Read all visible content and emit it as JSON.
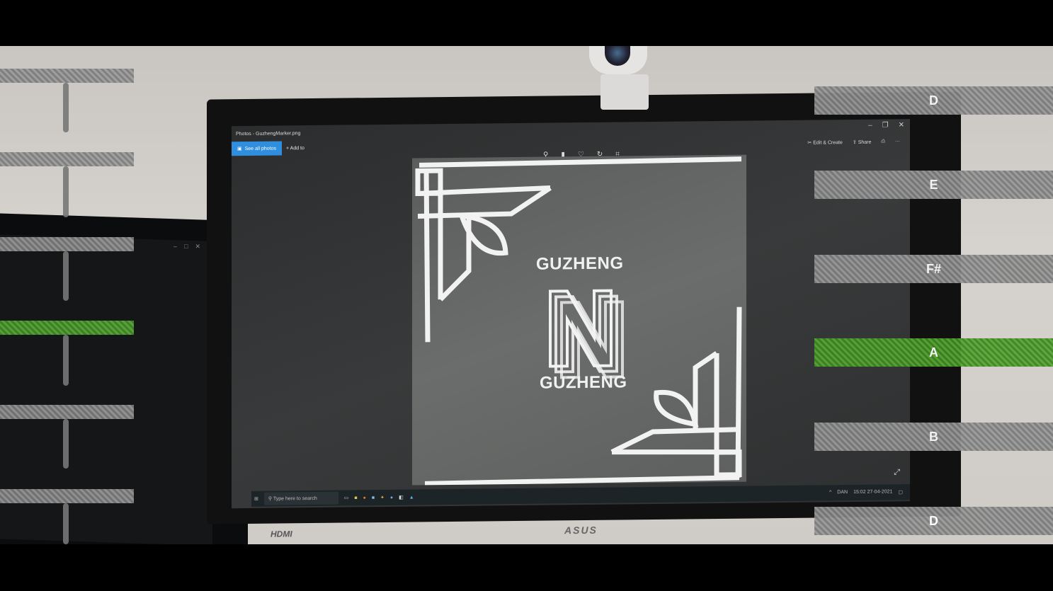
{
  "photos_app": {
    "window_title": "Photos - GuzhengMarker.png",
    "see_all_photos": "See all photos",
    "add_to": "Add to",
    "edit_create": "Edit & Create",
    "share": "Share",
    "more": "···",
    "image": {
      "logo_top": "GUZHENG",
      "logo_letter": "N",
      "logo_bottom": "GUZHENG"
    }
  },
  "taskbar": {
    "search_placeholder": "Type here to search",
    "language": "DAN",
    "time": "15:02",
    "date": "27-04-2021"
  },
  "monitor": {
    "brand": "ASUS",
    "port_label": "HDMI"
  },
  "notes": [
    {
      "label": "D",
      "active": false
    },
    {
      "label": "E",
      "active": false
    },
    {
      "label": "F#",
      "active": false
    },
    {
      "label": "A",
      "active": true
    },
    {
      "label": "B",
      "active": false
    },
    {
      "label": "D",
      "active": false
    }
  ],
  "colors": {
    "active_string": "#4f9a2f",
    "inactive_string": "#8a8a8a",
    "photos_accent": "#2f8fde"
  },
  "icons": {
    "zoom": "zoom-icon",
    "delete": "trash-icon",
    "favorite": "heart-icon",
    "rotate": "rotate-icon",
    "crop": "crop-icon",
    "print": "print-icon",
    "expand": "expand-icon"
  }
}
